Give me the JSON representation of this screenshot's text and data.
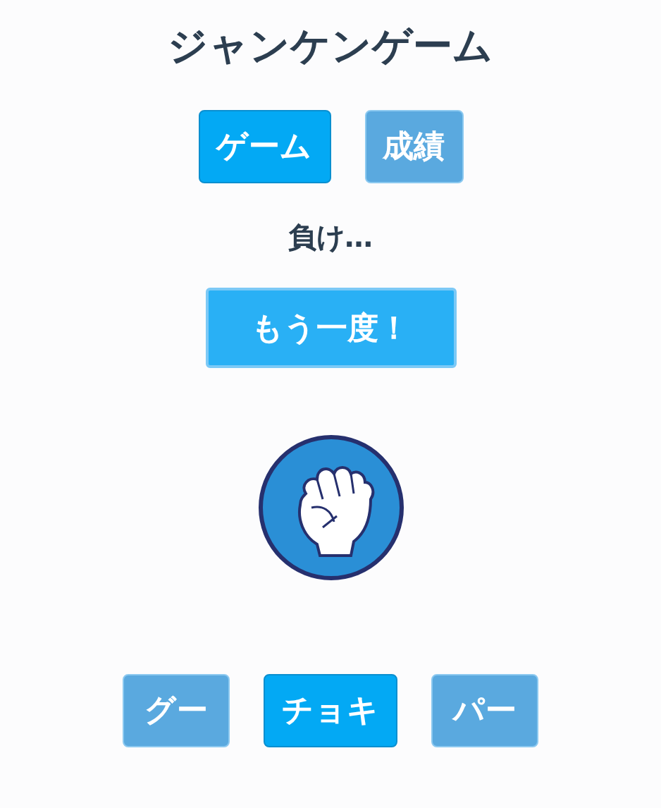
{
  "title": "ジャンケンゲーム",
  "tabs": [
    {
      "label": "ゲーム",
      "selected": true
    },
    {
      "label": "成績",
      "selected": false
    }
  ],
  "result": "負け…",
  "retry_button": "もう一度！",
  "hands": [
    {
      "label": "グー",
      "selected": false
    },
    {
      "label": "チョキ",
      "selected": true
    },
    {
      "label": "パー",
      "selected": false
    }
  ]
}
